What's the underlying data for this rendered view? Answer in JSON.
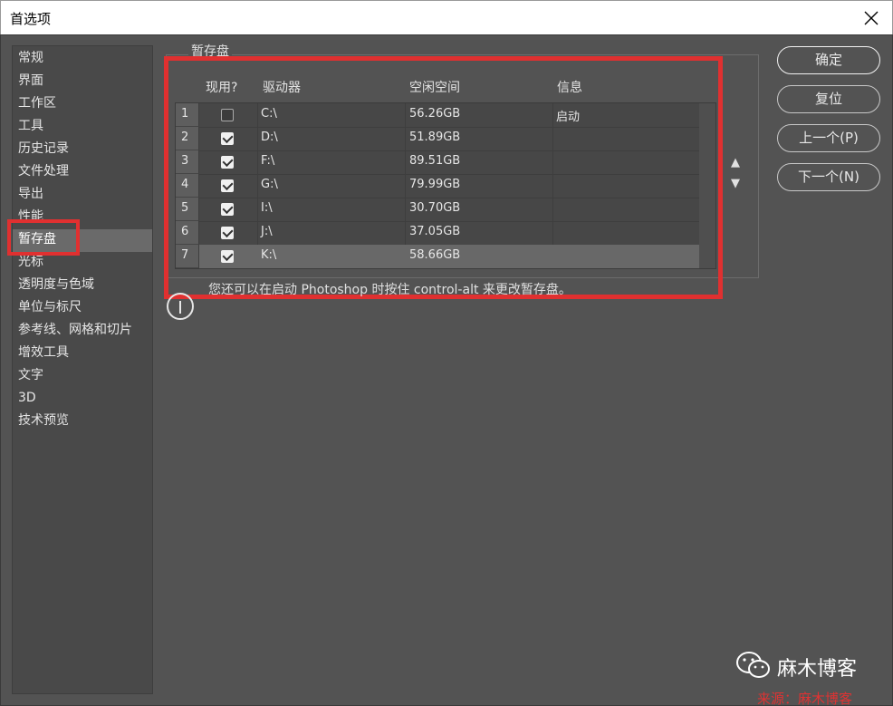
{
  "window": {
    "title": "首选项"
  },
  "sidebar": {
    "items": [
      {
        "label": "常规"
      },
      {
        "label": "界面"
      },
      {
        "label": "工作区"
      },
      {
        "label": "工具"
      },
      {
        "label": "历史记录"
      },
      {
        "label": "文件处理"
      },
      {
        "label": "导出"
      },
      {
        "label": "性能"
      },
      {
        "label": "暂存盘"
      },
      {
        "label": "光标"
      },
      {
        "label": "透明度与色域"
      },
      {
        "label": "单位与标尺"
      },
      {
        "label": "参考线、网格和切片"
      },
      {
        "label": "增效工具"
      },
      {
        "label": "文字"
      },
      {
        "label": "3D"
      },
      {
        "label": "技术预览"
      }
    ],
    "selected": "暂存盘"
  },
  "scratch": {
    "group_label": "暂存盘",
    "headers": {
      "active": "现用?",
      "drive": "驱动器",
      "free": "空闲空间",
      "info": "信息"
    },
    "rows": [
      {
        "num": "1",
        "checked": false,
        "drive": "C:\\",
        "free": "56.26GB",
        "info": "启动"
      },
      {
        "num": "2",
        "checked": true,
        "drive": "D:\\",
        "free": "51.89GB",
        "info": ""
      },
      {
        "num": "3",
        "checked": true,
        "drive": "F:\\",
        "free": "89.51GB",
        "info": ""
      },
      {
        "num": "4",
        "checked": true,
        "drive": "G:\\",
        "free": "79.99GB",
        "info": ""
      },
      {
        "num": "5",
        "checked": true,
        "drive": "I:\\",
        "free": "30.70GB",
        "info": ""
      },
      {
        "num": "6",
        "checked": true,
        "drive": "J:\\",
        "free": "37.05GB",
        "info": ""
      },
      {
        "num": "7",
        "checked": true,
        "drive": "K:\\",
        "free": "58.66GB",
        "info": ""
      }
    ],
    "selected_row": "7",
    "move_up": "▲",
    "move_down": "▼",
    "note": "您还可以在启动 Photoshop 时按住 control-alt 来更改暂存盘。"
  },
  "buttons": {
    "ok": "确定",
    "reset": "复位",
    "prev": "上一个(P)",
    "next": "下一个(N)"
  },
  "watermark": {
    "text": "麻木博客",
    "source": "来源：麻木博客"
  },
  "colors": {
    "highlight": "#e03030",
    "background": "#535353"
  }
}
